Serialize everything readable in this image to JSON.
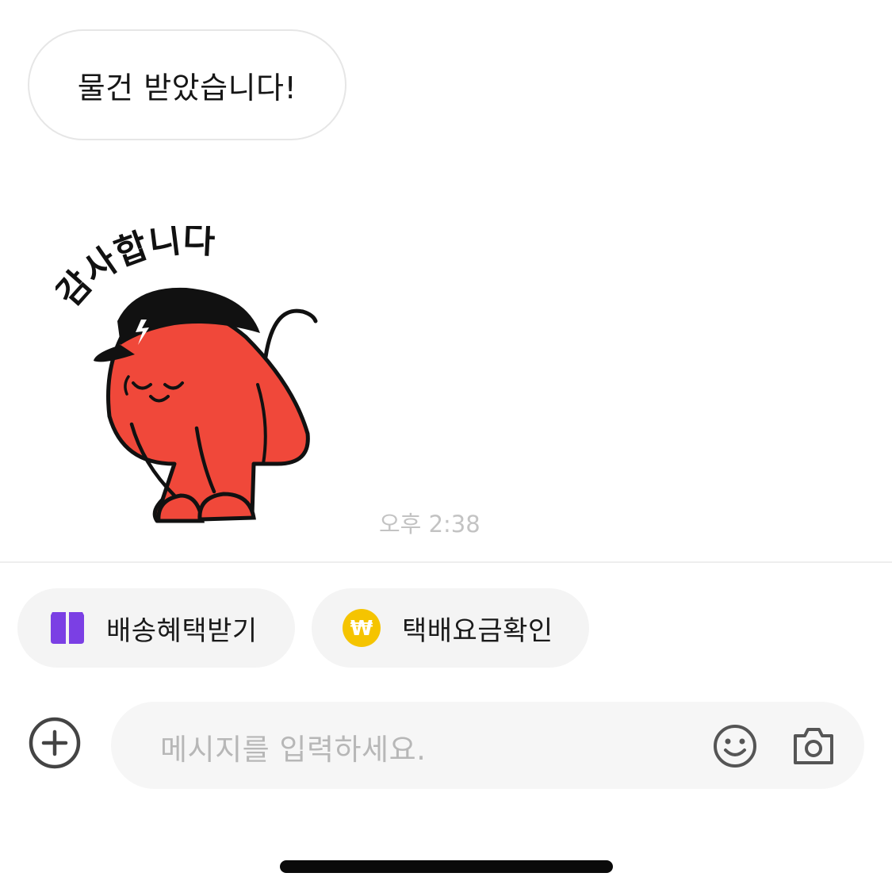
{
  "messages": {
    "received_text": "물건 받았습니다!",
    "sticker": {
      "caption": "감사합니다",
      "name": "bowing-red-character-sticker"
    },
    "timestamp": "오후 2:38"
  },
  "quick_actions": [
    {
      "label": "배송혜택받기",
      "icon": "delivery-box-icon",
      "icon_color": "#7b3fe4"
    },
    {
      "label": "택배요금확인",
      "icon": "won-coin-icon",
      "icon_color": "#f5c400"
    }
  ],
  "composer": {
    "placeholder": "메시지를 입력하세요.",
    "attach_icon": "plus-circle-icon",
    "emoji_icon": "smiley-icon",
    "camera_icon": "camera-icon"
  },
  "colors": {
    "sticker_red": "#f0483a",
    "accent_purple": "#7b3fe4",
    "coin_yellow": "#f5c400"
  }
}
